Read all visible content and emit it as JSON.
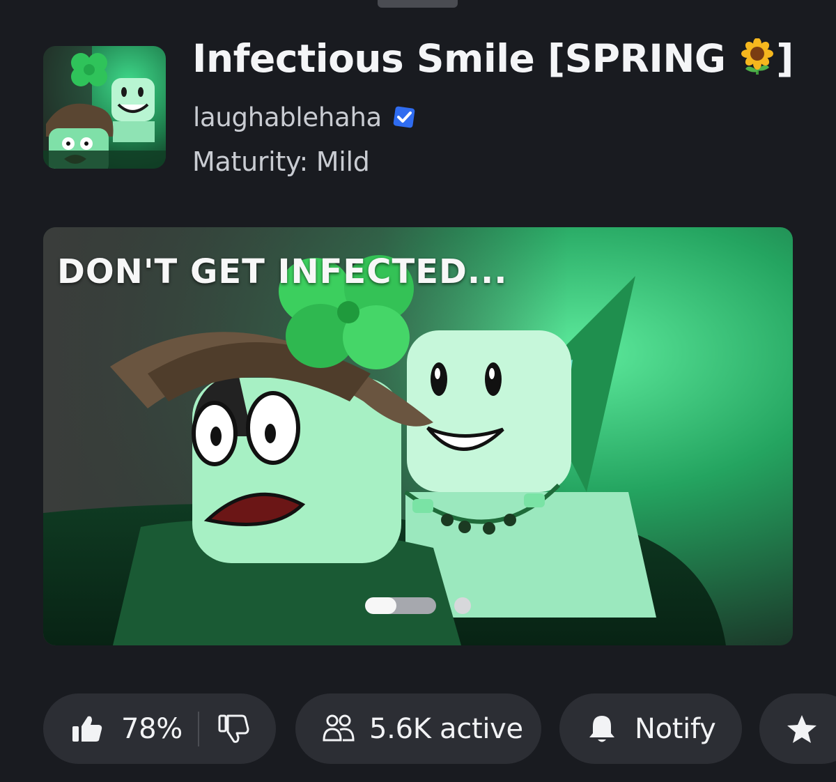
{
  "game": {
    "title": "Infectious Smile [SPRING",
    "title_end": "]",
    "title_emoji": "sunflower-icon",
    "creator": "laughablehaha",
    "creator_verified": true,
    "maturity": "Maturity: Mild"
  },
  "banner": {
    "caption": "DON'T GET INFECTED...",
    "slide_count": 2,
    "current_slide": 1,
    "autoplay_progress": 0.44
  },
  "stats": {
    "rating": "78%",
    "active": "5.6K active",
    "notify_label": "Notify"
  },
  "icons": {
    "like": "thumbs-up-icon",
    "dislike": "thumbs-down-icon",
    "active": "people-icon",
    "notify": "bell-icon",
    "favorite": "star-icon"
  },
  "colors": {
    "background": "#191b20",
    "pill": "#2c2e34",
    "verified_badge": "#2f6cf0",
    "accent_green": "#3fd98a"
  }
}
